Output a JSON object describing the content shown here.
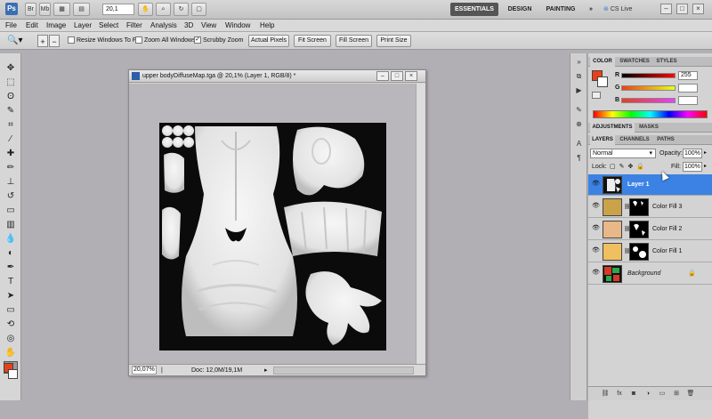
{
  "app": {
    "logo": "Ps",
    "zoom_select": "20,1",
    "workspaces": [
      "ESSENTIALS",
      "DESIGN",
      "PAINTING",
      "»"
    ],
    "cs_live": "CS Live",
    "window_controls": [
      "–",
      "□",
      "×"
    ]
  },
  "menu": [
    "File",
    "Edit",
    "Image",
    "Layer",
    "Select",
    "Filter",
    "Analysis",
    "3D",
    "View",
    "Window",
    "Help"
  ],
  "options": {
    "resize_windows": {
      "label": "Resize Windows To Fit",
      "checked": false
    },
    "zoom_all_windows": {
      "label": "Zoom All Windows",
      "checked": false
    },
    "scrubby_zoom": {
      "label": "Scrubby Zoom",
      "checked": true
    },
    "buttons": [
      "Actual Pixels",
      "Fit Screen",
      "Fill Screen",
      "Print Size"
    ]
  },
  "document": {
    "title": "upper bodyDiffuseMap.tga @ 20,1% (Layer 1, RGB/8) *",
    "zoom": "20,07%",
    "doc_size": "Doc: 12,0M/19,1M"
  },
  "color_panel": {
    "tabs": [
      "COLOR",
      "SWATCHES",
      "STYLES"
    ],
    "channels": [
      {
        "label": "R",
        "value": "255",
        "gradient": "#ff0000"
      },
      {
        "label": "G",
        "value": "",
        "gradient": "#00ff00"
      },
      {
        "label": "B",
        "value": "",
        "gradient": "#0000ff"
      }
    ],
    "foreground": "#e8401a",
    "background": "#ffffff"
  },
  "adjustments_tabs": [
    "ADJUSTMENTS",
    "MASKS"
  ],
  "layers_panel": {
    "tabs": [
      "LAYERS",
      "CHANNELS",
      "PATHS"
    ],
    "blend_mode": "Normal",
    "opacity_label": "Opacity:",
    "opacity": "100%",
    "lock_label": "Lock:",
    "fill_label": "Fill:",
    "fill": "100%",
    "layers": [
      {
        "name": "Layer 1",
        "selected": true,
        "thumb": "#ffffff"
      },
      {
        "name": "Color Fill 3",
        "selected": false,
        "thumb": "#c9a24a"
      },
      {
        "name": "Color Fill 2",
        "selected": false,
        "thumb": "#e8b888"
      },
      {
        "name": "Color Fill 1",
        "selected": false,
        "thumb": "#f0c060"
      },
      {
        "name": "Background",
        "selected": false,
        "thumb": "#d43a2a"
      }
    ]
  }
}
